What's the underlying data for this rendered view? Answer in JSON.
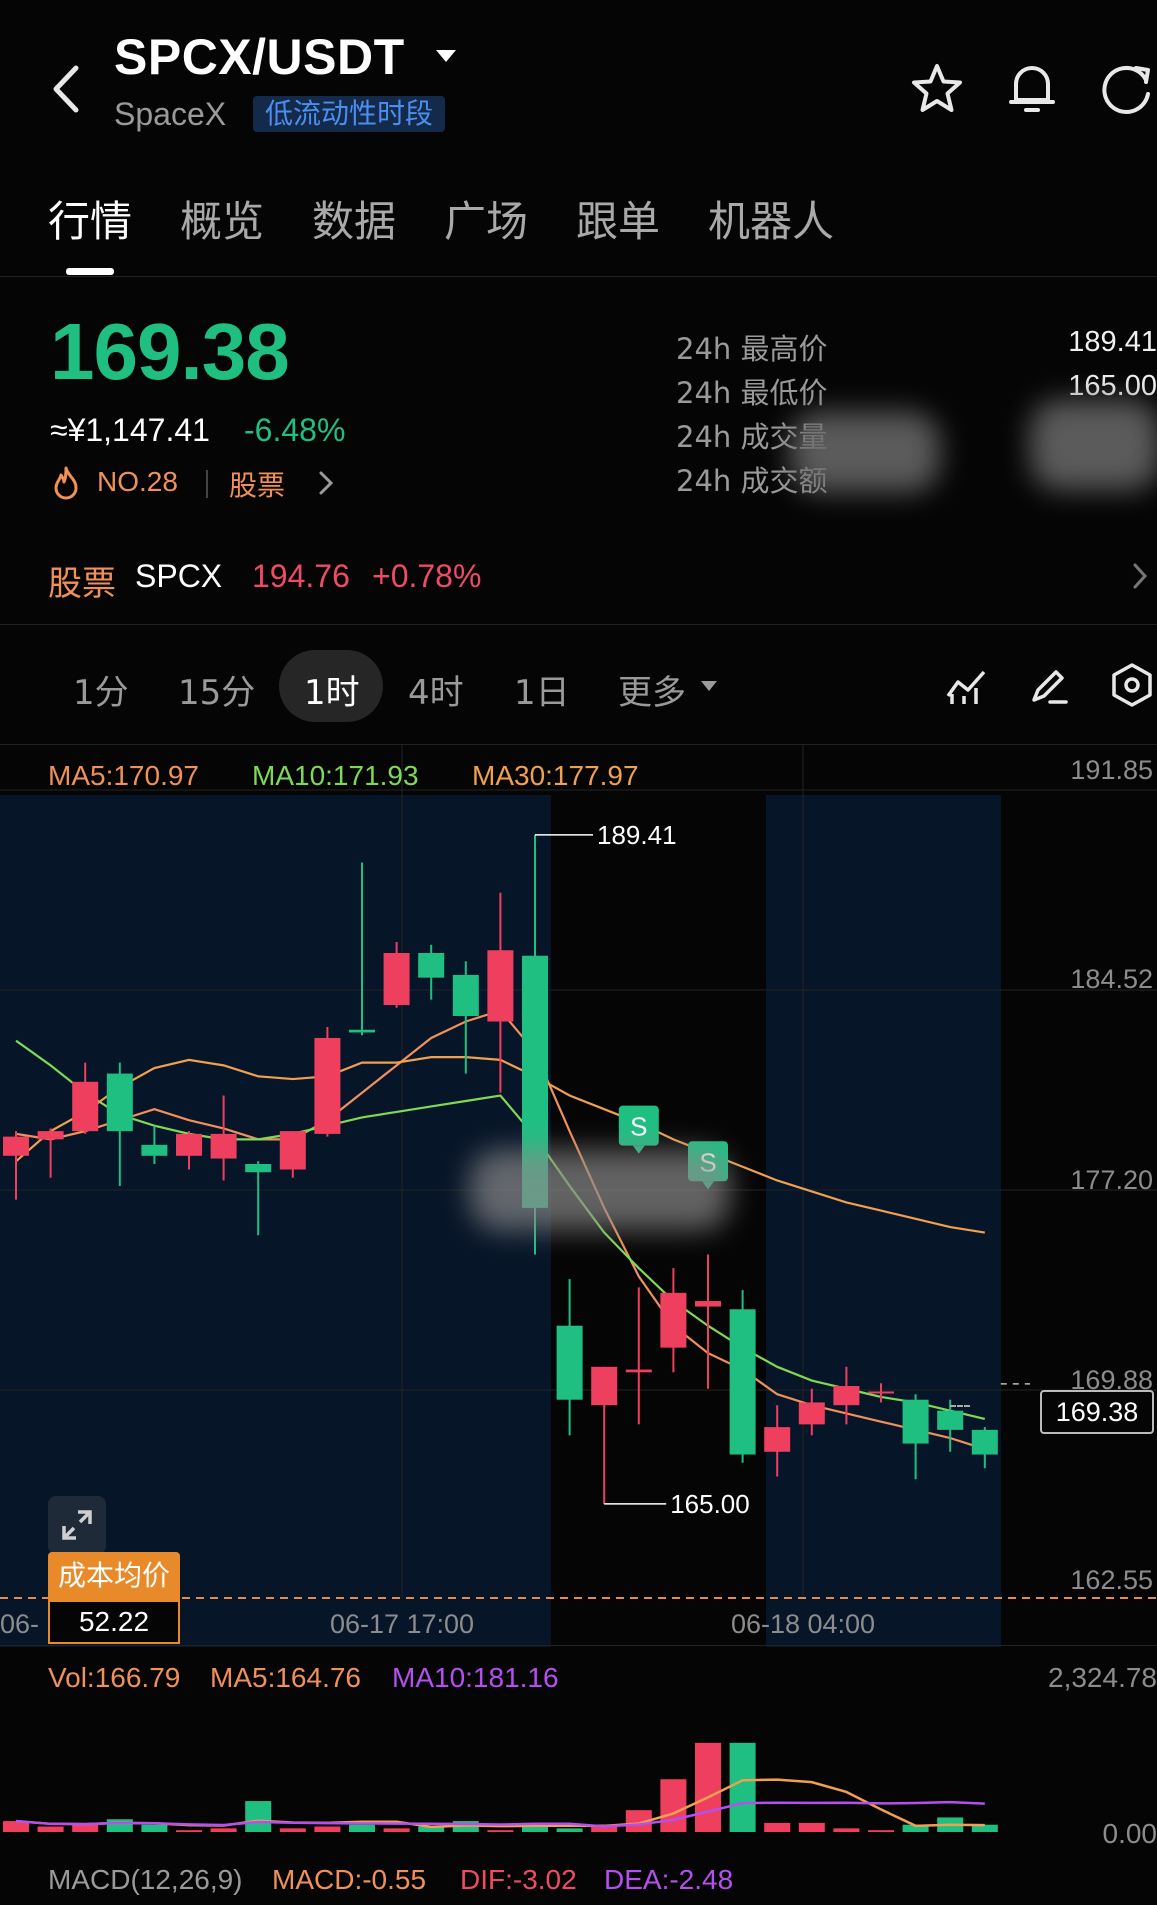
{
  "header": {
    "pair": "SPCX/USDT",
    "name": "SpaceX",
    "badge": "低流动性时段"
  },
  "tabs": [
    "行情",
    "概览",
    "数据",
    "广场",
    "跟单",
    "机器人"
  ],
  "active_tab": "行情",
  "ticker": {
    "last_price": "169.38",
    "approx_cny": "≈¥1,147.41",
    "change_pct": "-6.48%",
    "rank": "NO.28",
    "category": "股票",
    "stats": [
      {
        "label": "24h 最高价",
        "value": "189.41"
      },
      {
        "label": "24h 最低价",
        "value": "165.00"
      },
      {
        "label": "24h 成交量",
        "value": ""
      },
      {
        "label": "24h 成交额",
        "value": ""
      }
    ]
  },
  "stock_ref": {
    "label": "股票",
    "symbol": "SPCX",
    "price": "194.76",
    "change": "+0.78%"
  },
  "intervals": [
    "1分",
    "15分",
    "1时",
    "4时",
    "1日",
    "更多"
  ],
  "active_interval": "1时",
  "main_chart": {
    "ma_labels": {
      "ma5": "MA5:170.97",
      "ma10": "MA10:171.93",
      "ma30": "MA30:177.97"
    },
    "y_ticks": [
      "191.85",
      "184.52",
      "177.20",
      "169.88",
      "162.55"
    ],
    "time_labels": [
      "06-",
      "06-17 17:00",
      "06-18 04:00"
    ],
    "high_marker": "189.41",
    "low_marker": "165.00",
    "last_price_tag": "169.38",
    "cost_label": "成本均价",
    "cost_value": "52.22",
    "signal": "S"
  },
  "volume": {
    "vol_label": "Vol:166.79",
    "ma5_label": "MA5:164.76",
    "ma10_label": "MA10:181.16",
    "y_top": "2,324.78",
    "y_bottom": "0.00"
  },
  "macd": {
    "title": "MACD(12,26,9)",
    "macd": "MACD:-0.55",
    "dif": "DIF:-3.02",
    "dea": "DEA:-2.48"
  },
  "chart_data": {
    "type": "candlestick",
    "ylim": [
      162.55,
      191.85
    ],
    "candles": [
      {
        "o": 177.7,
        "h": 178.6,
        "l": 176.1,
        "c": 178.4
      },
      {
        "o": 178.3,
        "h": 178.7,
        "l": 176.9,
        "c": 178.6
      },
      {
        "o": 178.6,
        "h": 181.1,
        "l": 178.5,
        "c": 180.4
      },
      {
        "o": 180.7,
        "h": 181.1,
        "l": 176.6,
        "c": 178.6
      },
      {
        "o": 178.1,
        "h": 178.8,
        "l": 177.4,
        "c": 177.7
      },
      {
        "o": 177.7,
        "h": 178.6,
        "l": 177.2,
        "c": 178.5
      },
      {
        "o": 177.6,
        "h": 179.9,
        "l": 176.8,
        "c": 178.5
      },
      {
        "o": 177.4,
        "h": 177.5,
        "l": 174.8,
        "c": 177.1
      },
      {
        "o": 177.2,
        "h": 178.6,
        "l": 176.9,
        "c": 178.6
      },
      {
        "o": 178.5,
        "h": 182.4,
        "l": 178.4,
        "c": 182.0
      },
      {
        "o": 182.3,
        "h": 188.4,
        "l": 182.1,
        "c": 182.2
      },
      {
        "o": 183.2,
        "h": 185.5,
        "l": 183.1,
        "c": 185.1
      },
      {
        "o": 185.1,
        "h": 185.4,
        "l": 183.4,
        "c": 184.2
      },
      {
        "o": 184.3,
        "h": 184.8,
        "l": 180.7,
        "c": 182.8
      },
      {
        "o": 182.6,
        "h": 187.3,
        "l": 180.0,
        "c": 185.2
      },
      {
        "o": 185.0,
        "h": 189.41,
        "l": 174.1,
        "c": 175.8
      },
      {
        "o": 171.5,
        "h": 173.2,
        "l": 167.5,
        "c": 168.8
      },
      {
        "o": 168.6,
        "h": 170.0,
        "l": 165.0,
        "c": 170.0
      },
      {
        "o": 169.8,
        "h": 172.9,
        "l": 167.9,
        "c": 169.9
      },
      {
        "o": 170.7,
        "h": 173.6,
        "l": 169.8,
        "c": 172.7
      },
      {
        "o": 172.2,
        "h": 174.1,
        "l": 169.2,
        "c": 172.4
      },
      {
        "o": 172.1,
        "h": 172.8,
        "l": 166.5,
        "c": 166.8
      },
      {
        "o": 166.9,
        "h": 168.6,
        "l": 166.0,
        "c": 167.8
      },
      {
        "o": 167.9,
        "h": 169.2,
        "l": 167.5,
        "c": 168.7
      },
      {
        "o": 168.6,
        "h": 170.0,
        "l": 167.9,
        "c": 169.3
      },
      {
        "o": 169.1,
        "h": 169.4,
        "l": 168.7,
        "c": 169.1
      },
      {
        "o": 168.8,
        "h": 169.0,
        "l": 165.9,
        "c": 167.2
      },
      {
        "o": 168.4,
        "h": 168.8,
        "l": 166.9,
        "c": 167.7
      },
      {
        "o": 167.7,
        "h": 167.8,
        "l": 166.3,
        "c": 166.8
      }
    ],
    "series": [
      {
        "values": [
          178.5,
          178.3,
          178.6,
          179.0,
          179.4,
          179.0,
          178.7,
          178.3,
          178.3,
          179.0,
          180.0,
          181.0,
          182.0,
          182.6,
          183.0,
          181.5,
          178.6,
          175.8,
          173.3,
          171.5,
          170.5,
          169.9,
          169.0,
          168.6,
          168.3,
          168.0,
          167.7,
          167.4,
          167.0
        ]
      },
      {
        "values": [
          181.9,
          181.0,
          180.0,
          179.2,
          178.8,
          178.5,
          178.3,
          178.3,
          178.5,
          178.8,
          179.1,
          179.3,
          179.5,
          179.7,
          179.9,
          178.4,
          176.6,
          174.9,
          173.6,
          172.4,
          171.5,
          170.7,
          170.0,
          169.5,
          169.2,
          168.9,
          168.7,
          168.4,
          168.1
        ]
      },
      {
        "values": [
          177.5,
          178.6,
          179.3,
          180.2,
          180.9,
          181.2,
          181.0,
          180.6,
          180.5,
          180.6,
          181.1,
          181.1,
          181.3,
          181.3,
          181.2,
          180.6,
          179.9,
          179.4,
          178.9,
          178.3,
          177.8,
          177.3,
          176.8,
          176.4,
          176.0,
          175.7,
          175.4,
          175.1,
          174.9
        ]
      }
    ],
    "volume": [
      0.06,
      0.03,
      0.04,
      0.07,
      0.04,
      0.01,
      0.02,
      0.17,
      0.02,
      0.03,
      0.04,
      0.02,
      0.03,
      0.06,
      0.01,
      0.05,
      0.02,
      0.03,
      0.12,
      0.29,
      0.49,
      0.49,
      0.05,
      0.05,
      0.02,
      0.01,
      0.04,
      0.08,
      0.04
    ],
    "volume_scale_max": 2324.78
  }
}
